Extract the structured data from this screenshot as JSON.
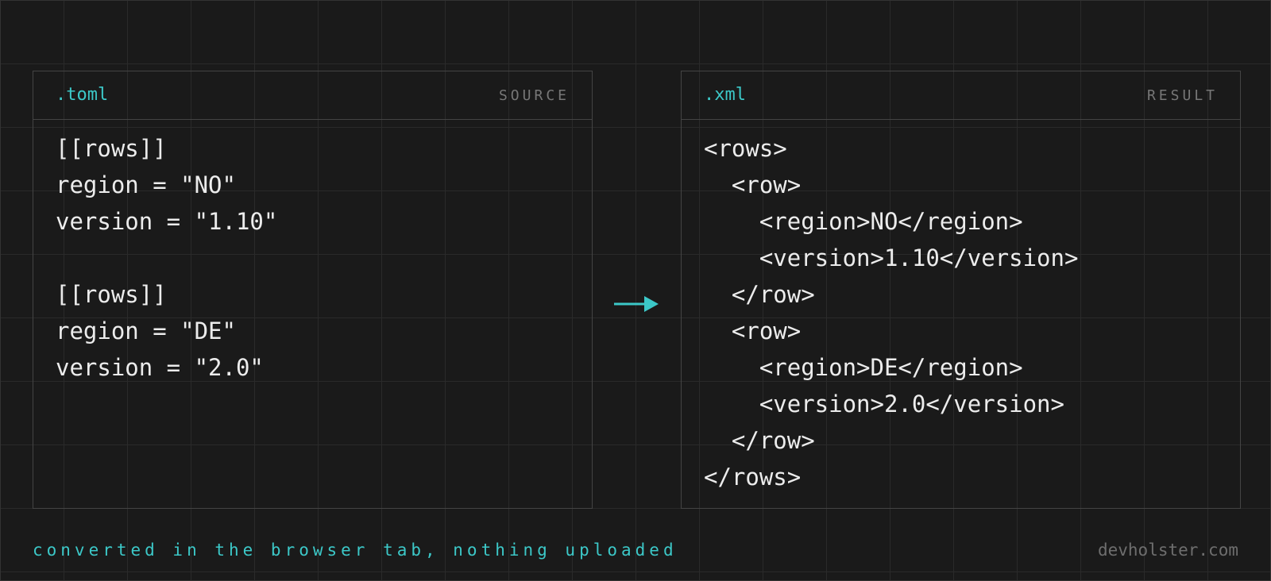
{
  "source_panel": {
    "extension": ".toml",
    "role": "SOURCE",
    "lines": [
      "[[rows]]",
      "region = \"NO\"",
      "version = \"1.10\"",
      "",
      "[[rows]]",
      "region = \"DE\"",
      "version = \"2.0\""
    ]
  },
  "result_panel": {
    "extension": ".xml",
    "role": "RESULT",
    "lines": [
      "<rows>",
      "  <row>",
      "    <region>NO</region>",
      "    <version>1.10</version>",
      "  </row>",
      "  <row>",
      "    <region>DE</region>",
      "    <version>2.0</version>",
      "  </row>",
      "</rows>"
    ]
  },
  "arrow_icon": "arrow-right-icon",
  "footer": {
    "note": "converted in the browser tab, nothing uploaded",
    "brand": "devholster.com"
  },
  "colors": {
    "background": "#1a1a1a",
    "grid": "#2a2a2a",
    "panel_border": "#444444",
    "accent": "#3cc8c8",
    "text": "#ececec",
    "muted": "#777777"
  }
}
